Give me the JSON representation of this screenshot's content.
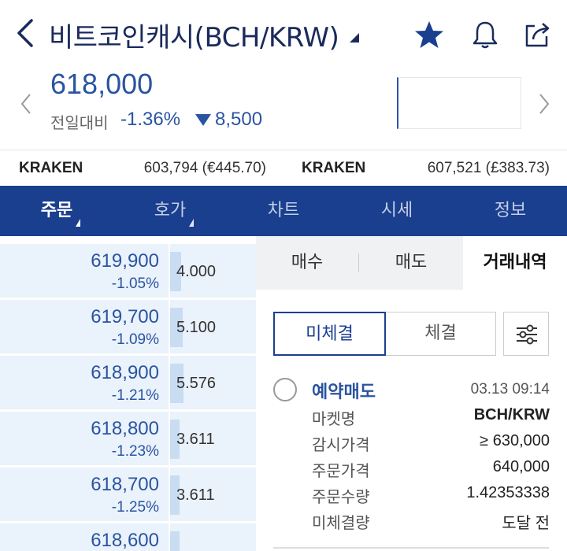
{
  "header": {
    "title": "비트코인캐시(BCH/KRW)",
    "icons": [
      "back-icon",
      "star-icon",
      "bell-icon",
      "share-icon"
    ]
  },
  "price": {
    "current": "618,000",
    "change_label": "전일대비",
    "change_pct": "-1.36%",
    "change_amt": "8,500"
  },
  "exchanges": [
    {
      "name": "KRAKEN",
      "value": "603,794 (€445.70)"
    },
    {
      "name": "KRAKEN",
      "value": "607,521 (£383.73)"
    }
  ],
  "tabs": [
    {
      "label": "주문",
      "active": true,
      "caret": true
    },
    {
      "label": "호가",
      "active": false,
      "caret": true
    },
    {
      "label": "차트",
      "active": false,
      "caret": false
    },
    {
      "label": "시세",
      "active": false,
      "caret": false
    },
    {
      "label": "정보",
      "active": false,
      "caret": false
    }
  ],
  "orderbook": [
    {
      "price": "619,900",
      "pct": "-1.05%",
      "qty": "4.000"
    },
    {
      "price": "619,700",
      "pct": "-1.09%",
      "qty": "5.100"
    },
    {
      "price": "618,900",
      "pct": "-1.21%",
      "qty": "5.576"
    },
    {
      "price": "618,800",
      "pct": "-1.23%",
      "qty": "3.611"
    },
    {
      "price": "618,700",
      "pct": "-1.25%",
      "qty": "3.611"
    },
    {
      "price": "618,600",
      "pct": "",
      "qty": ""
    }
  ],
  "subtabs": [
    {
      "label": "매수",
      "active": false
    },
    {
      "label": "매도",
      "active": false
    },
    {
      "label": "거래내역",
      "active": true
    }
  ],
  "segments": {
    "unfilled": "미체결",
    "filled": "체결"
  },
  "order": {
    "type": "예약매도",
    "time": "03.13 09:14",
    "rows": [
      {
        "label": "마켓명",
        "value": "BCH/KRW",
        "bold": true
      },
      {
        "label": "감시가격",
        "value": "≥ 630,000",
        "bold": false
      },
      {
        "label": "주문가격",
        "value": "640,000",
        "bold": false
      },
      {
        "label": "주문수량",
        "value": "1.42353338",
        "bold": false
      },
      {
        "label": "미체결량",
        "value": "도달 전",
        "bold": false
      }
    ]
  },
  "colors": {
    "brand": "#1b3f8f",
    "price_blue": "#2a54a0",
    "orderbook_bg": "#eaf2fb"
  }
}
